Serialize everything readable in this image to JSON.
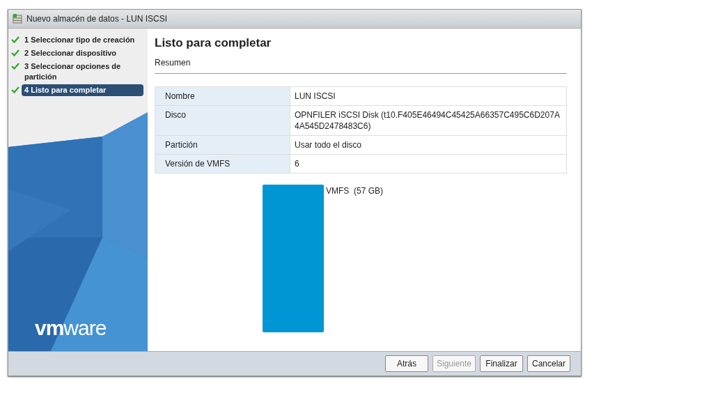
{
  "window": {
    "title": "Nuevo almacén de datos - LUN ISCSI"
  },
  "steps": [
    {
      "number": "1",
      "label": "Seleccionar tipo de creación",
      "checked": true,
      "selected": false
    },
    {
      "number": "2",
      "label": "Seleccionar dispositivo",
      "checked": true,
      "selected": false
    },
    {
      "number": "3",
      "label": "Seleccionar opciones de partición",
      "checked": true,
      "selected": false
    },
    {
      "number": "4",
      "label": "Listo para completar",
      "checked": true,
      "selected": true
    }
  ],
  "logo": "**vm**ware",
  "page": {
    "title": "Listo para completar",
    "subtitle": "Resumen"
  },
  "summary": [
    {
      "label": "Nombre",
      "value": "LUN ISCSI"
    },
    {
      "label": "Disco",
      "value": "OPNFILER iSCSI Disk (t10.F405E46494C45425A66357C495C6D207A4A545D2478483C6)"
    },
    {
      "label": "Partición",
      "value": "Usar todo el disco"
    },
    {
      "label": "Versión de VMFS",
      "value": "6"
    }
  ],
  "partition": {
    "label": "VMFS",
    "size": "(57 GB)"
  },
  "buttons": [
    {
      "label": "Atrás",
      "disabled": false
    },
    {
      "label": "Siguiente",
      "disabled": true
    },
    {
      "label": "Finalizar",
      "disabled": false
    },
    {
      "label": "Cancelar",
      "disabled": false
    }
  ]
}
